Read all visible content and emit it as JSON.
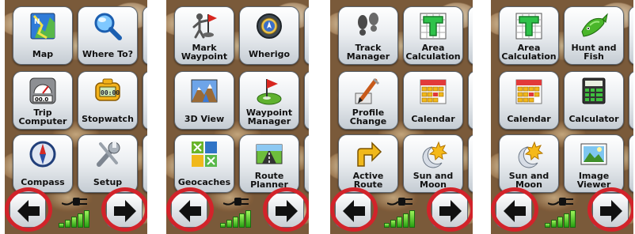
{
  "screens": [
    {
      "tiles": [
        {
          "label": "Map",
          "icon": "map-icon"
        },
        {
          "label": "Where To?",
          "icon": "magnifier-icon"
        },
        {
          "label": "Trip Computer",
          "icon": "trip-computer-icon"
        },
        {
          "label": "Stopwatch",
          "icon": "stopwatch-icon"
        },
        {
          "label": "Compass",
          "icon": "compass-icon"
        },
        {
          "label": "Setup",
          "icon": "wrench-icon"
        }
      ]
    },
    {
      "tiles": [
        {
          "label": "Mark Waypoint",
          "icon": "mark-waypoint-icon"
        },
        {
          "label": "Wherigo",
          "icon": "wherigo-icon"
        },
        {
          "label": "3D View",
          "icon": "3d-view-icon"
        },
        {
          "label": "Waypoint Manager",
          "icon": "waypoint-manager-icon"
        },
        {
          "label": "Geocaches",
          "icon": "geocaches-icon"
        },
        {
          "label": "Route Planner",
          "icon": "route-planner-icon"
        }
      ]
    },
    {
      "tiles": [
        {
          "label": "Track Manager",
          "icon": "footprints-icon"
        },
        {
          "label": "Area Calculation",
          "icon": "area-calculation-icon"
        },
        {
          "label": "Profile Change",
          "icon": "paintbrush-icon"
        },
        {
          "label": "Calendar",
          "icon": "calendar-icon"
        },
        {
          "label": "Active Route",
          "icon": "active-route-icon"
        },
        {
          "label": "Sun and Moon",
          "icon": "sun-moon-icon"
        }
      ]
    },
    {
      "tiles": [
        {
          "label": "Area Calculation",
          "icon": "area-calculation-icon"
        },
        {
          "label": "Hunt and Fish",
          "icon": "fish-icon"
        },
        {
          "label": "Calendar",
          "icon": "calendar-icon"
        },
        {
          "label": "Calculator",
          "icon": "calculator-icon"
        },
        {
          "label": "Sun and Moon",
          "icon": "sun-moon-icon"
        },
        {
          "label": "Image Viewer",
          "icon": "image-viewer-icon"
        }
      ]
    }
  ],
  "nav": {
    "prev": "arrow-left-icon",
    "next": "arrow-right-icon"
  },
  "status": {
    "power": "plug-icon",
    "battery": "battery-level-icon"
  },
  "colors": {
    "highlight": "#d2232a",
    "tile": "#eceff2",
    "battery": "#3fbf1f"
  }
}
